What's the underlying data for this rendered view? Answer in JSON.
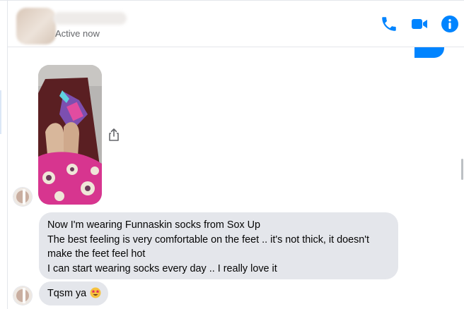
{
  "header": {
    "status": "Active now",
    "icons": [
      "phone-icon",
      "video-camera-icon",
      "info-icon"
    ],
    "accent_color": "#0084ff"
  },
  "messages": {
    "photo_icon": "share-icon",
    "long_message": {
      "lines": [
        "Now I'm wearing Funnaskin socks from Sox Up",
        "The best feeling is very comfortable on the feet .. it's not thick, it doesn't",
        "make the feet feel hot",
        "I can start wearing socks every day .. I really love it"
      ]
    },
    "short_message": {
      "text": "Tqsm ya",
      "emoji_icon": "star-struck-emoji-icon"
    },
    "bubble_color": "#e4e6eb"
  }
}
